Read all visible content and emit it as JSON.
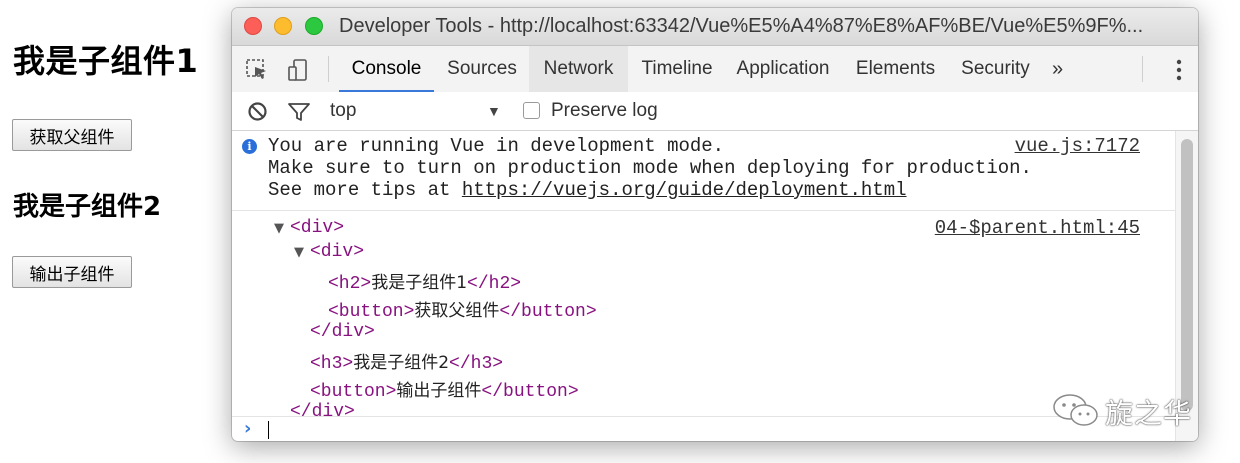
{
  "page": {
    "heading1": "我是子组件1",
    "button1": "获取父组件",
    "heading2": "我是子组件2",
    "button2": "输出子组件"
  },
  "devtools": {
    "window_title": "Developer Tools - http://localhost:63342/Vue%E5%A4%87%E8%AF%BE/Vue%E5%9F%...",
    "toolbar_icons": [
      "inspect-element-icon",
      "device-mode-icon"
    ],
    "tabs": [
      {
        "label": "Console",
        "active": true
      },
      {
        "label": "Sources"
      },
      {
        "label": "Network"
      },
      {
        "label": "Timeline"
      },
      {
        "label": "Application"
      },
      {
        "label": "Elements"
      },
      {
        "label": "Security"
      }
    ],
    "overflow_glyph": "»",
    "filter": {
      "context": "top",
      "dropdown_glyph": "▼",
      "preserve_log_label": "Preserve log"
    },
    "messages": {
      "info": {
        "line1": "You are running Vue in development mode.",
        "line2": "Make sure to turn on production mode when deploying for production.",
        "line3_prefix": "See more tips at ",
        "line3_url": "https://vuejs.org/guide/deployment.html",
        "source": "vue.js:7172"
      },
      "log": {
        "source": "04-$parent.html:45",
        "tree": {
          "r1_open": "<div>",
          "r2_open": "<div>",
          "r3_open": "<h2>",
          "r3_text": "我是子组件1",
          "r3_close": "</h2>",
          "r4_open": "<button>",
          "r4_text": "获取父组件",
          "r4_close": "</button>",
          "r5_close": "</div>",
          "r6_open": "<h3>",
          "r6_text": "我是子组件2",
          "r6_close": "</h3>",
          "r7_open": "<button>",
          "r7_text": "输出子组件",
          "r7_close": "</button>",
          "r8_close": "</div>"
        }
      }
    },
    "prompt_glyph": "›",
    "colors": {
      "accent": "#3879d9",
      "tag": "#881280",
      "info": "#2a6ed9"
    }
  },
  "watermark": {
    "text": "旋之华",
    "icon": "wechat-icon"
  }
}
